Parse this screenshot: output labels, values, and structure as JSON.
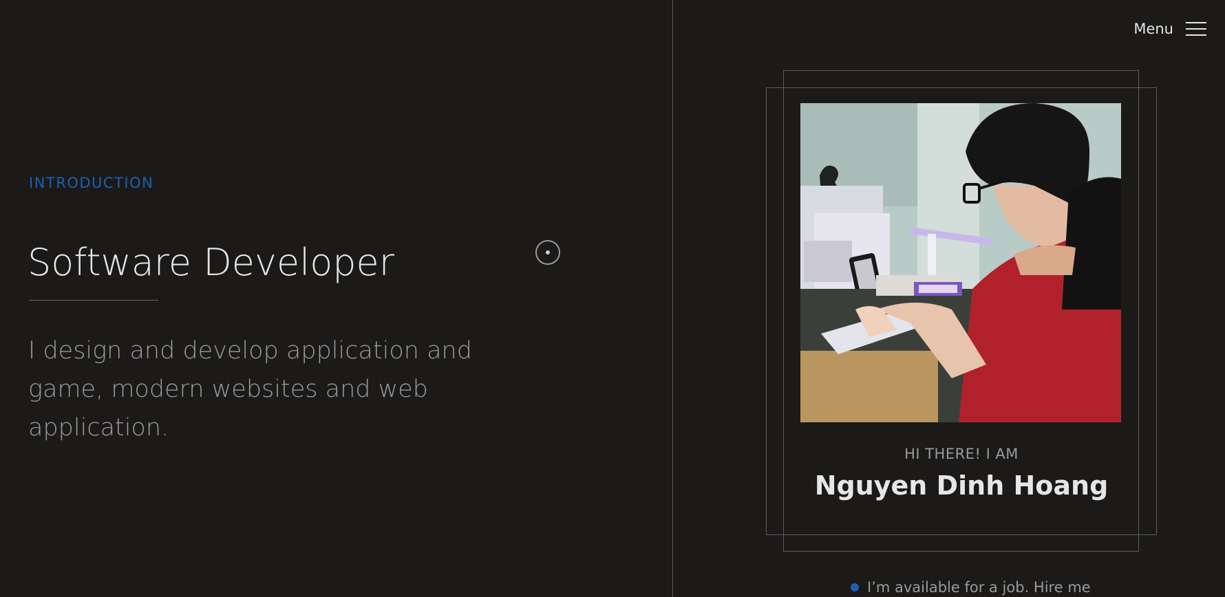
{
  "menu": {
    "label": "Menu"
  },
  "intro": {
    "label": "INTRODUCTION",
    "headline": "Software Developer",
    "lead": "I design and develop application and game, modern websites and web application."
  },
  "card": {
    "greeting": "HI THERE! I AM",
    "name": "Nguyen Dinh Hoang"
  },
  "availability": {
    "text": "I’m available for a job. Hire me"
  },
  "colors": {
    "background": "#1b1a19",
    "accent": "#1f5fb0",
    "text_primary": "#e6e6e6",
    "text_muted": "#9a9a9a",
    "border": "#5c5c5c"
  },
  "icons": {
    "menu": "hamburger-icon",
    "scroll": "scroll-indicator-icon",
    "status": "status-dot-icon"
  }
}
